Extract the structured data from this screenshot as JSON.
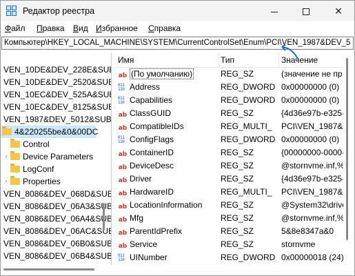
{
  "window": {
    "title": "Редактор реестра"
  },
  "menu": [
    {
      "label": "Файл",
      "underline": "Ф",
      "rest": "айл"
    },
    {
      "label": "Правка",
      "underline": "П",
      "rest": "равка"
    },
    {
      "label": "Вид",
      "underline": "В",
      "rest": "ид"
    },
    {
      "label": "Избранное",
      "underline": "И",
      "rest": "збранное"
    },
    {
      "label": "Справка",
      "underline": "С",
      "rest": "правка"
    }
  ],
  "address": {
    "path": "Компьютер\\HKEY_LOCAL_MACHINE\\SYSTEM\\CurrentControlSet\\Enum\\PCI\\VEN_1987&DEV_5"
  },
  "tree": {
    "items": [
      {
        "label": "VEN_10DE&DEV_228E&SUB",
        "level": 0
      },
      {
        "label": "VEN_10DE&DEV_2520&SUB",
        "level": 0
      },
      {
        "label": "VEN_10EC&DEV_525A&SUB",
        "level": 0
      },
      {
        "label": "VEN_10EC&DEV_8125&SUB",
        "level": 0
      },
      {
        "label": "VEN_1987&DEV_5012&SUB",
        "level": 0
      },
      {
        "label": "4&220255be&0&00DC",
        "level": 1,
        "selected": true
      },
      {
        "label": "Control",
        "level": 2
      },
      {
        "label": "Device Parameters",
        "level": 2,
        "expander": true
      },
      {
        "label": "LogConf",
        "level": 2
      },
      {
        "label": "Properties",
        "level": 2,
        "expander": true
      },
      {
        "label": "VEN_8086&DEV_068D&SUB",
        "level": 0
      },
      {
        "label": "VEN_8086&DEV_06A3&SUB",
        "level": 0
      },
      {
        "label": "VEN_8086&DEV_06A4&SUB",
        "level": 0
      },
      {
        "label": "VEN_8086&DEV_06AC&SUB",
        "level": 0
      },
      {
        "label": "VEN_8086&DEV_06B0&SUB",
        "level": 0
      },
      {
        "label": "VEN_8086&DEV_06B4&SUB",
        "level": 0
      }
    ]
  },
  "list": {
    "columns": {
      "name": "Имя",
      "type": "Тип",
      "data": "Значение"
    },
    "rows": [
      {
        "icon": "string-value-icon",
        "name": "(По умолчанию)",
        "type": "REG_SZ",
        "data": "(значение не пр",
        "default": true
      },
      {
        "icon": "binary-value-icon",
        "name": "Address",
        "type": "REG_DWORD",
        "data": "0x00000000 (0)"
      },
      {
        "icon": "binary-value-icon",
        "name": "Capabilities",
        "type": "REG_DWORD",
        "data": "0x00000000 (0)"
      },
      {
        "icon": "string-value-icon",
        "name": "ClassGUID",
        "type": "REG_SZ",
        "data": "{4d36e97b-e325-"
      },
      {
        "icon": "string-value-icon",
        "name": "CompatibleIDs",
        "type": "REG_MULTI_",
        "data": "PCI\\VEN_1987&D"
      },
      {
        "icon": "binary-value-icon",
        "name": "ConfigFlags",
        "type": "REG_DWORD",
        "data": "0x00000000 (0)"
      },
      {
        "icon": "string-value-icon",
        "name": "ContainerID",
        "type": "REG_SZ",
        "data": "{00000000-0000-("
      },
      {
        "icon": "string-value-icon",
        "name": "DeviceDesc",
        "type": "REG_SZ",
        "data": "@stornvme.inf,%"
      },
      {
        "icon": "string-value-icon",
        "name": "Driver",
        "type": "REG_SZ",
        "data": "{4d36e97b-e325-"
      },
      {
        "icon": "string-value-icon",
        "name": "HardwareID",
        "type": "REG_MULTI_",
        "data": "PCI\\VEN_1987&D"
      },
      {
        "icon": "string-value-icon",
        "name": "LocationInformation",
        "type": "REG_SZ",
        "data": "@System32\\drive"
      },
      {
        "icon": "string-value-icon",
        "name": "Mfg",
        "type": "REG_SZ",
        "data": "@stornvme.inf,%"
      },
      {
        "icon": "string-value-icon",
        "name": "ParentIdPrefix",
        "type": "REG_SZ",
        "data": "5&8e8347a&0"
      },
      {
        "icon": "string-value-icon",
        "name": "Service",
        "type": "REG_SZ",
        "data": "stornvme"
      },
      {
        "icon": "binary-value-icon",
        "name": "UINumber",
        "type": "REG_DWORD",
        "data": "0x00000018 (24)"
      }
    ]
  },
  "colors": {
    "selection": "#cce8ff",
    "folder": "#f3c54c",
    "arrow": "#1a6fd1",
    "string_icon": "#c0392b",
    "binary_icon": "#1a56c4"
  }
}
